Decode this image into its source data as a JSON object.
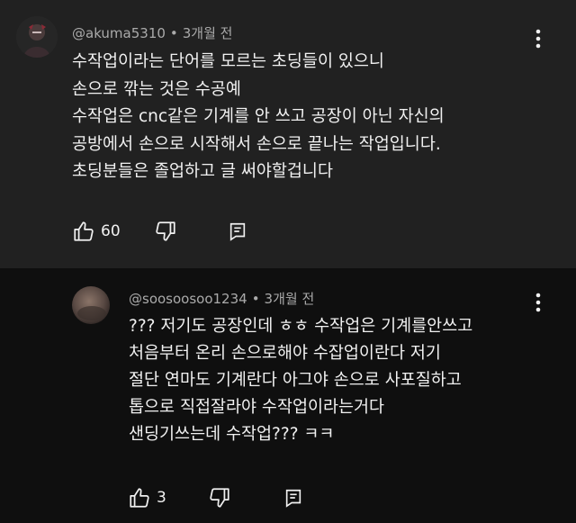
{
  "comments": [
    {
      "author": "@akuma5310",
      "time": "3개월 전",
      "lines": [
        "수작업이라는 단어를 모르는 초딩들이 있으니",
        "손으로 깎는 것은 수공예",
        "수작업은 cnc같은 기계를 안 쓰고 공장이 아닌 자신의",
        "공방에서 손으로 시작해서 손으로 끝나는 작업입니다.",
        "초딩분들은 졸업하고 글 써야할겁니다"
      ],
      "likes": "60",
      "icons": [
        "thumbs-up-icon",
        "thumbs-down-icon",
        "reply-icon",
        "more-vert-icon"
      ]
    },
    {
      "author": "@soosoosoo1234",
      "time": "3개월 전",
      "lines": [
        "??? 저기도 공장인데 ㅎㅎ 수작업은  기계를안쓰고",
        "처음부터  온리  손으로해야  수잡업이란다  저기",
        "절단 연마도 기계란다 아그야 손으로 사포질하고",
        "톱으로  직접잘라야 수작업이라는거다",
        "샌딩기쓰는데 수작업???   ㅋㅋ"
      ],
      "likes": "3",
      "icons": [
        "thumbs-up-icon",
        "thumbs-down-icon",
        "reply-icon",
        "more-vert-icon"
      ]
    }
  ]
}
